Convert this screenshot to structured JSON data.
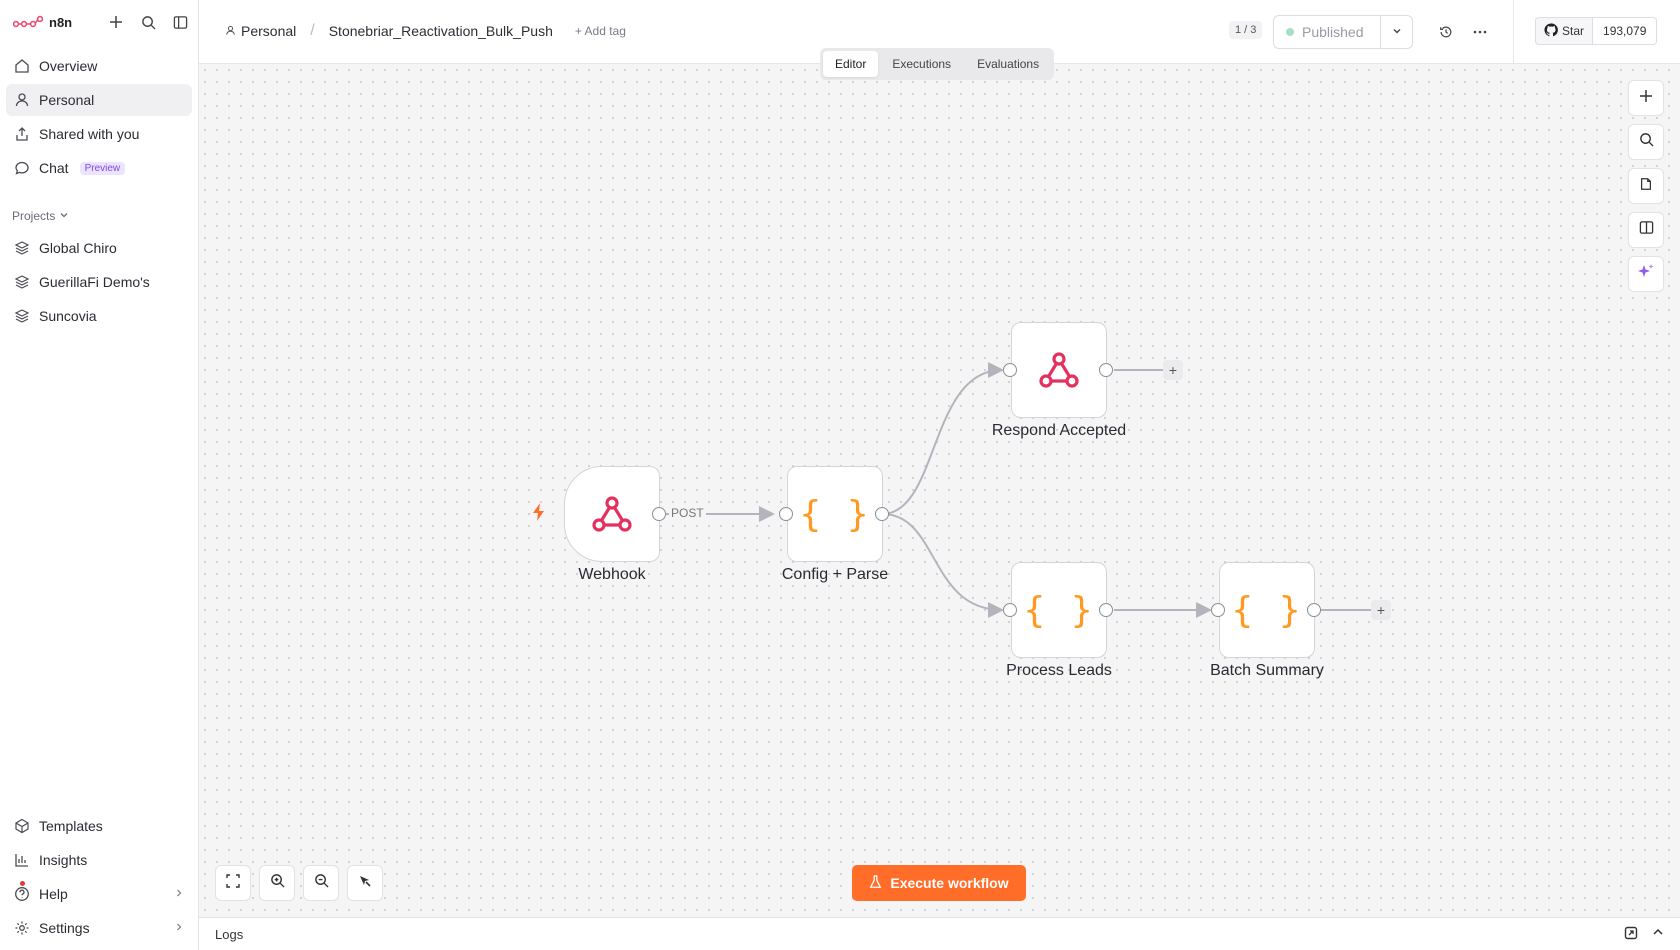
{
  "app": {
    "name": "n8n"
  },
  "sidebar": {
    "items": [
      {
        "label": "Overview",
        "icon": "home-icon"
      },
      {
        "label": "Personal",
        "icon": "user-icon",
        "active": true
      },
      {
        "label": "Shared with you",
        "icon": "share-icon"
      },
      {
        "label": "Chat",
        "icon": "chat-icon",
        "badge": "Preview"
      }
    ],
    "projects_label": "Projects",
    "projects": [
      {
        "label": "Global Chiro",
        "icon": "layers-icon"
      },
      {
        "label": "GuerillaFi Demo's",
        "icon": "layers-icon"
      },
      {
        "label": "Suncovia",
        "icon": "layers-icon"
      }
    ],
    "bottom": [
      {
        "label": "Templates",
        "icon": "templates-icon"
      },
      {
        "label": "Insights",
        "icon": "chart-icon"
      },
      {
        "label": "Help",
        "icon": "help-icon"
      },
      {
        "label": "Settings",
        "icon": "gear-icon"
      }
    ]
  },
  "header": {
    "breadcrumb_project": "Personal",
    "workflow_name": "Stonebriar_Reactivation_Bulk_Push",
    "add_tag": "+ Add tag",
    "version_counter": "1 / 3",
    "publish_label": "Published",
    "github_star": "Star",
    "github_count": "193,079",
    "tabs": [
      "Editor",
      "Executions",
      "Evaluations"
    ],
    "active_tab": "Editor"
  },
  "canvas": {
    "nodes": [
      {
        "name": "Webhook",
        "type": "webhook"
      },
      {
        "name": "Config + Parse",
        "type": "code"
      },
      {
        "name": "Respond Accepted",
        "type": "webhook"
      },
      {
        "name": "Process Leads",
        "type": "code"
      },
      {
        "name": "Batch Summary",
        "type": "code"
      }
    ],
    "edge_label": "POST",
    "execute_label": "Execute workflow",
    "accent": "#ff6d29",
    "webhook_color": "#e5305f",
    "code_color": "#ff9922"
  },
  "logs": {
    "label": "Logs"
  }
}
